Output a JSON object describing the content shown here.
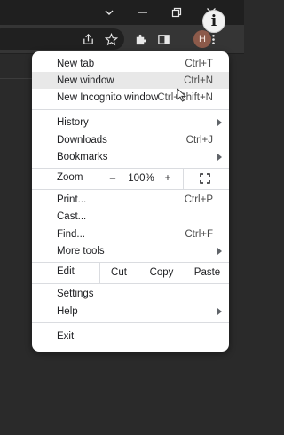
{
  "window_controls": {
    "chevron_icon": "chevron-down-icon",
    "minimize_icon": "minimize-icon",
    "restore_icon": "restore-icon",
    "close_icon": "close-icon",
    "info_glyph": "i"
  },
  "toolbar": {
    "avatar_letter": "H"
  },
  "menu": {
    "new_tab": {
      "label": "New tab",
      "shortcut": "Ctrl+T"
    },
    "new_window": {
      "label": "New window",
      "shortcut": "Ctrl+N"
    },
    "new_incognito": {
      "label": "New Incognito window",
      "shortcut": "Ctrl+Shift+N"
    },
    "history": {
      "label": "History"
    },
    "downloads": {
      "label": "Downloads",
      "shortcut": "Ctrl+J"
    },
    "bookmarks": {
      "label": "Bookmarks"
    },
    "zoom": {
      "label": "Zoom",
      "minus": "–",
      "value": "100%",
      "plus": "+"
    },
    "print": {
      "label": "Print...",
      "shortcut": "Ctrl+P"
    },
    "cast": {
      "label": "Cast..."
    },
    "find": {
      "label": "Find...",
      "shortcut": "Ctrl+F"
    },
    "more_tools": {
      "label": "More tools"
    },
    "edit": {
      "label": "Edit",
      "cut": "Cut",
      "copy": "Copy",
      "paste": "Paste"
    },
    "settings": {
      "label": "Settings"
    },
    "help": {
      "label": "Help"
    },
    "exit": {
      "label": "Exit"
    }
  }
}
